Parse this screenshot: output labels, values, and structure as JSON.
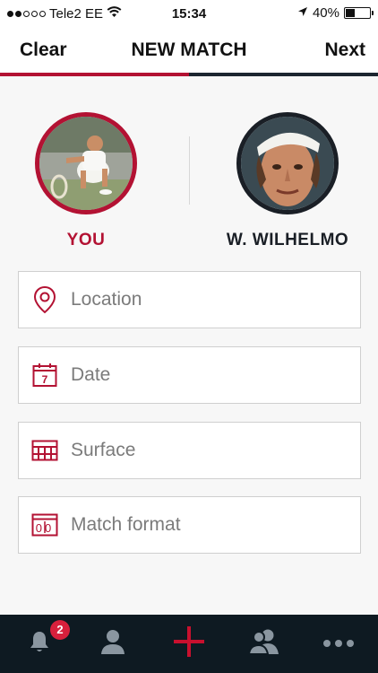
{
  "status_bar": {
    "carrier": "Tele2 EE",
    "time": "15:34",
    "battery": "40%",
    "battery_level": 0.4
  },
  "nav": {
    "left_label": "Clear",
    "title": "NEW MATCH",
    "right_label": "Next",
    "progress": 0.5
  },
  "players": {
    "you": {
      "name": "YOU",
      "avatar_icon": "player-photo"
    },
    "opponent": {
      "name": "W. WILHELMO",
      "avatar_icon": "opponent-photo"
    }
  },
  "fields": [
    {
      "label": "Location",
      "icon": "location-pin-icon"
    },
    {
      "label": "Date",
      "icon": "calendar-icon",
      "icon_text": "7"
    },
    {
      "label": "Surface",
      "icon": "court-grid-icon"
    },
    {
      "label": "Match format",
      "icon": "scoreboard-icon",
      "icon_text": "00"
    }
  ],
  "tabbar": {
    "items": [
      "notifications-icon",
      "profile-icon",
      "add-match-icon",
      "friends-icon",
      "more-icon"
    ],
    "badge_count": "2"
  },
  "colors": {
    "accent": "#b31233",
    "dark": "#1a1f26",
    "tabbar_bg": "#0e1a22",
    "badge": "#d8203c"
  }
}
